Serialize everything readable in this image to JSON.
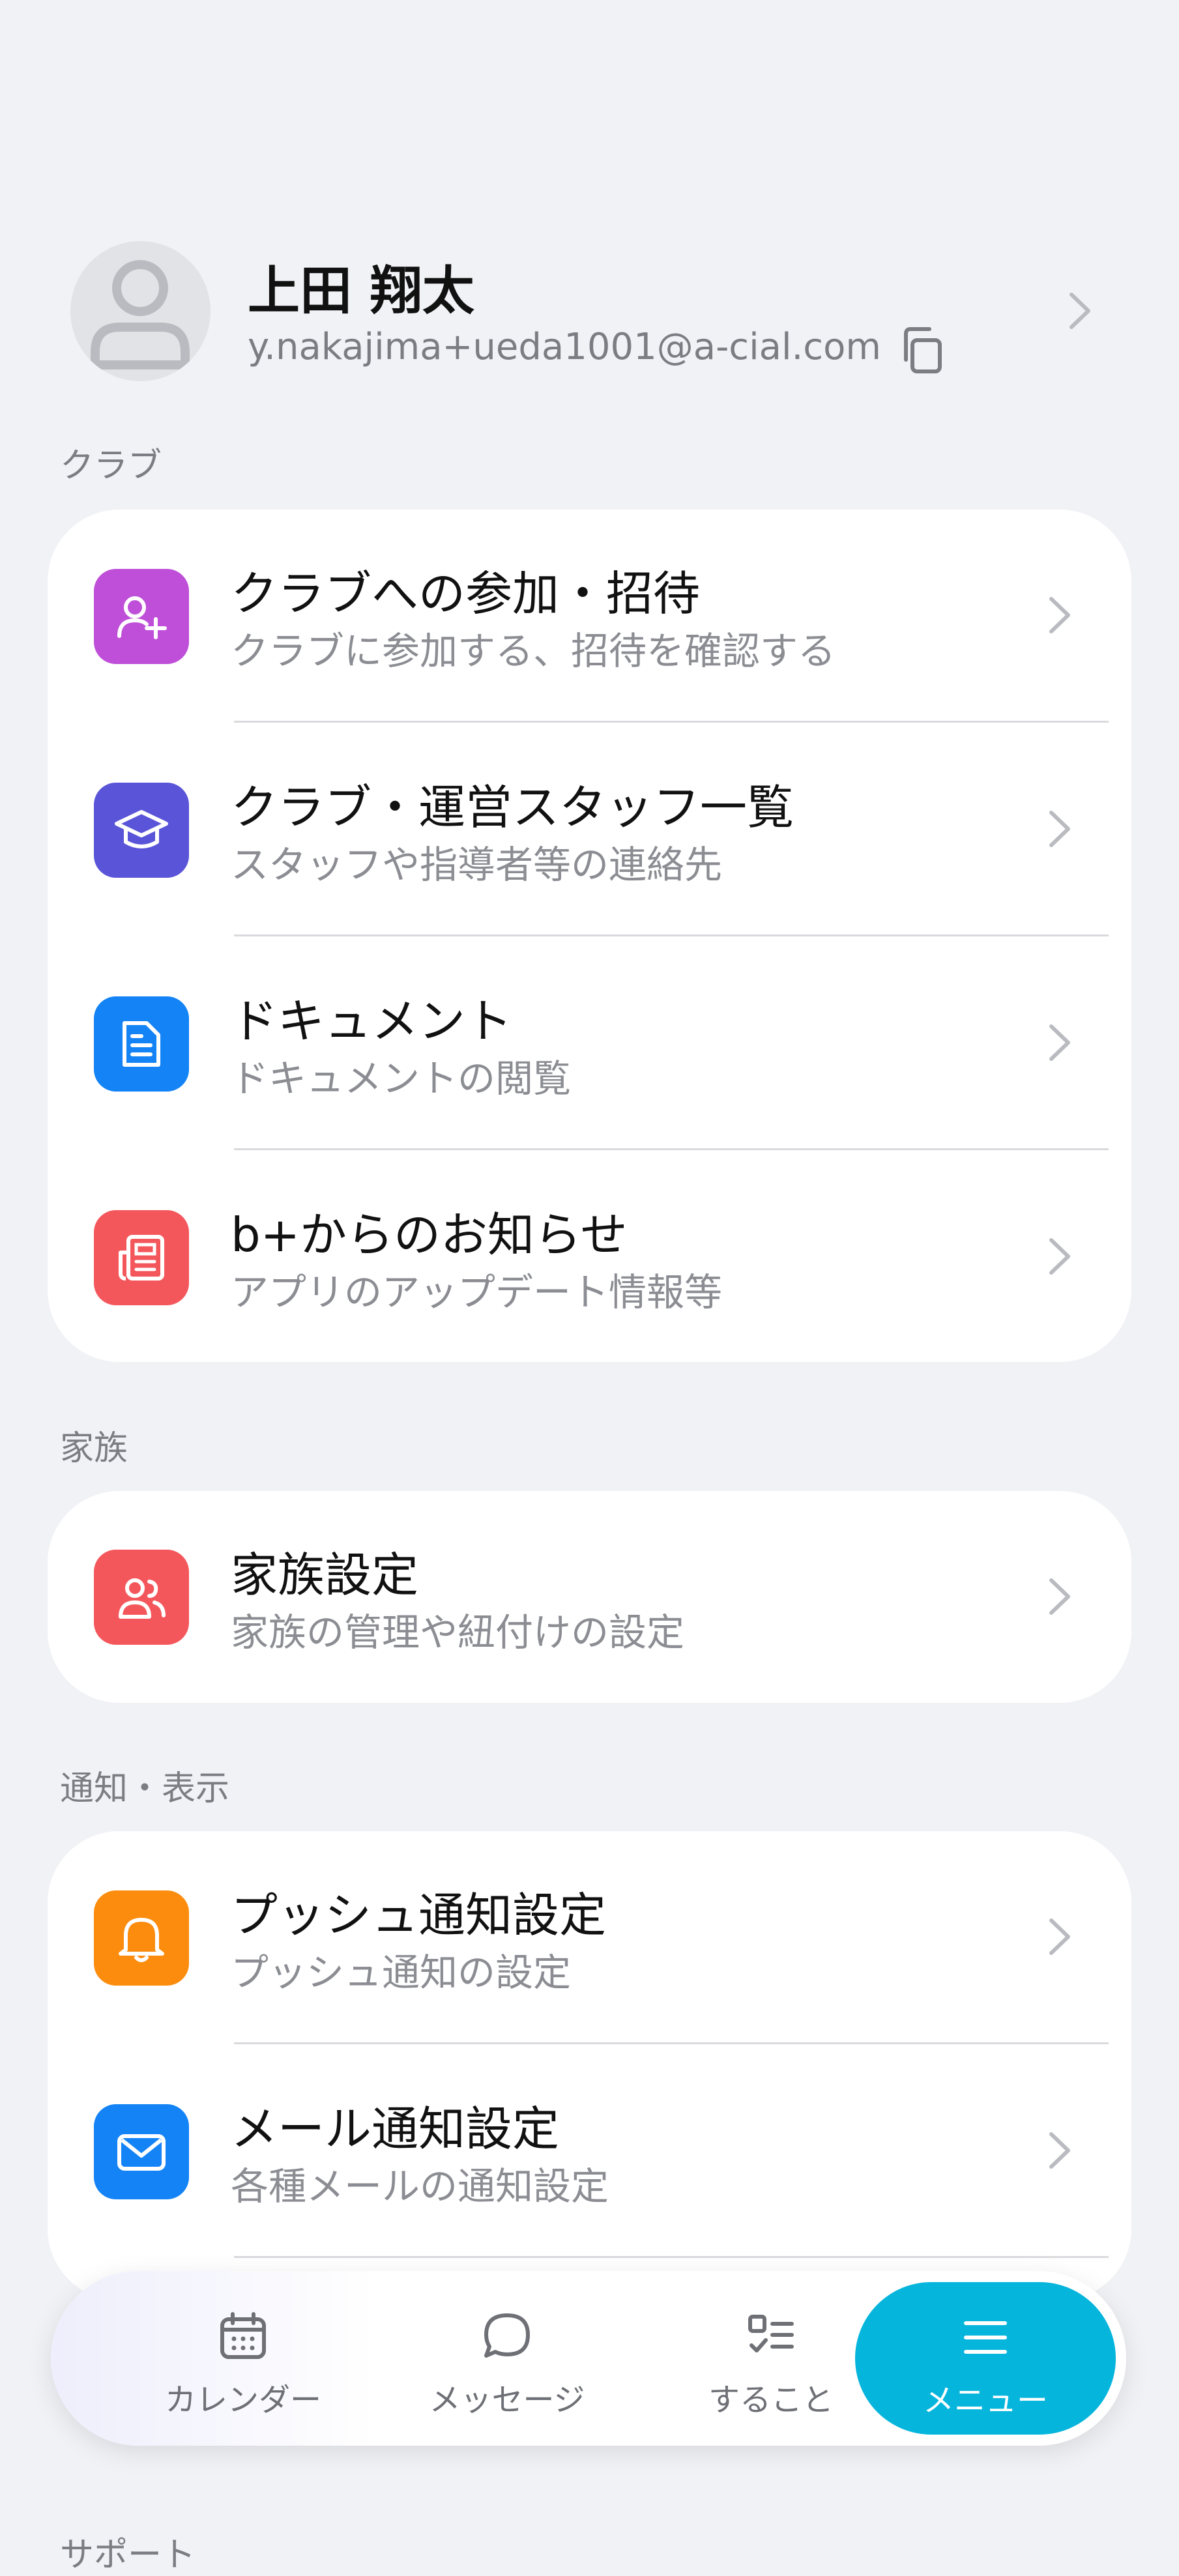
{
  "profile": {
    "name": "上田 翔太",
    "email": "y.nakajima+ueda1001@a-cial.com"
  },
  "sections": {
    "club": {
      "label": "クラブ",
      "items": [
        {
          "title": "クラブへの参加・招待",
          "subtitle": "クラブに参加する、招待を確認する",
          "icon": "person-add-icon",
          "color": "#bf4fd9"
        },
        {
          "title": "クラブ・運営スタッフ一覧",
          "subtitle": "スタッフや指導者等の連絡先",
          "icon": "graduation-cap-icon",
          "color": "#5a55d8"
        },
        {
          "title": "ドキュメント",
          "subtitle": "ドキュメントの閲覧",
          "icon": "document-icon",
          "color": "#1483f5"
        },
        {
          "title": "b+からのお知らせ",
          "subtitle": "アプリのアップデート情報等",
          "icon": "newspaper-icon",
          "color": "#f4575b"
        }
      ]
    },
    "family": {
      "label": "家族",
      "items": [
        {
          "title": "家族設定",
          "subtitle": "家族の管理や紐付けの設定",
          "icon": "family-icon",
          "color": "#f4575b"
        }
      ]
    },
    "notify": {
      "label": "通知・表示",
      "items": [
        {
          "title": "プッシュ通知設定",
          "subtitle": "プッシュ通知の設定",
          "icon": "bell-icon",
          "color": "#fb8c0e"
        },
        {
          "title": "メール通知設定",
          "subtitle": "各種メールの通知設定",
          "icon": "mail-icon",
          "color": "#1483f5"
        }
      ]
    },
    "support": {
      "label": "サポート"
    }
  },
  "tabbar": {
    "tabs": [
      {
        "label": "カレンダー",
        "icon": "calendar-icon"
      },
      {
        "label": "メッセージ",
        "icon": "chat-bubble-icon"
      },
      {
        "label": "すること",
        "icon": "checklist-icon"
      },
      {
        "label": "メニュー",
        "icon": "menu-icon",
        "active": true
      }
    ]
  },
  "colors": {
    "accent": "#05b5dc",
    "background": "#f1f2f6"
  }
}
